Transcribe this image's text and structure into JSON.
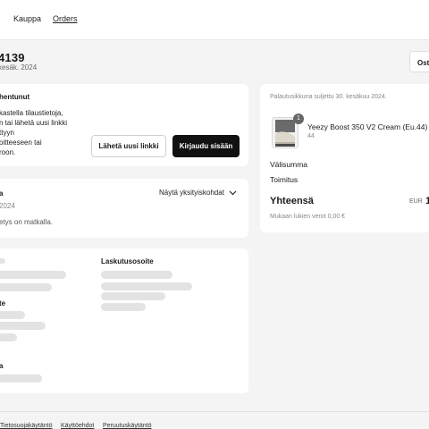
{
  "nav": {
    "shop": "Kauppa",
    "orders": "Orders"
  },
  "order": {
    "number": "4139",
    "date": "kesäk. 2024",
    "top_button": "Ostä"
  },
  "notice": {
    "title": "hentunut",
    "lines": [
      "kastella tilaustietoja,",
      "n tai lähetä uusi linkki",
      "ttyyn",
      "oitteeseen tai",
      "roon."
    ],
    "send_link": "Lähetä uusi linkki",
    "login": "Kirjaudu sisään"
  },
  "status": {
    "title": "a",
    "date": "2024",
    "toggle": "Näytä yksityiskohdat",
    "message": "etys on matkalla."
  },
  "addresses": {
    "billing_label": "Laskutusosoite",
    "left_label_2": "te",
    "left_label_3": "a"
  },
  "summary": {
    "return_window": "Palautusikkuna suljettu 30. kesäkuu 2024.",
    "product_name": "Yeezy Boost 350 V2 Cream (Eu.44)",
    "product_size": "44",
    "product_qty": "1",
    "subtotal_label": "Välisumma",
    "shipping_label": "Toimitus",
    "total_label": "Yhteensä",
    "currency": "EUR",
    "total_value": "1",
    "tax_note": "Mukaan lukien verot 0,00 €"
  },
  "footer": {
    "links": [
      "Tietosuojakäytäntö",
      "Käyttöehdot",
      "Peruutuskäytäntö"
    ]
  }
}
